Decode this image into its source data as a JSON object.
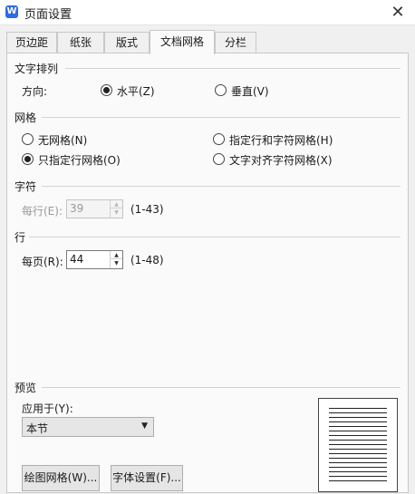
{
  "window": {
    "title": "页面设置",
    "app_icon_letter": "W"
  },
  "tabs": [
    {
      "label": "页边距",
      "active": false
    },
    {
      "label": "纸张",
      "active": false
    },
    {
      "label": "版式",
      "active": false
    },
    {
      "label": "文档网格",
      "active": true
    },
    {
      "label": "分栏",
      "active": false
    }
  ],
  "text_arrangement": {
    "section": "文字排列",
    "direction_label": "方向:",
    "options": [
      {
        "label": "水平(Z)",
        "checked": true
      },
      {
        "label": "垂直(V)",
        "checked": false
      }
    ]
  },
  "grid": {
    "section": "网格",
    "options": [
      {
        "label": "无网格(N)",
        "checked": false
      },
      {
        "label": "指定行和字符网格(H)",
        "checked": false
      },
      {
        "label": "只指定行网格(O)",
        "checked": true
      },
      {
        "label": "文字对齐字符网格(X)",
        "checked": false
      }
    ]
  },
  "characters": {
    "section": "字符",
    "per_line_label": "每行(E):",
    "per_line_value": "39",
    "range": "(1-43)",
    "enabled": false
  },
  "lines": {
    "section": "行",
    "per_page_label": "每页(R):",
    "per_page_value": "44",
    "range": "(1-48)"
  },
  "preview": {
    "section": "预览",
    "apply_to_label": "应用于(Y):",
    "apply_to_value": "本节",
    "page_line_count": 17
  },
  "buttons": {
    "draw_grid": "绘图网格(W)...",
    "font_settings": "字体设置(F)..."
  }
}
